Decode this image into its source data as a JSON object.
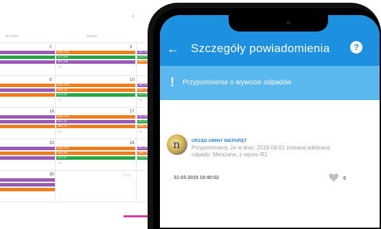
{
  "calendar": {
    "nav_icon": "chevron-left-icon",
    "nav_glyph": "‹",
    "day_headers": [
      "WTOREK",
      "ŚRODA"
    ],
    "colors": {
      "purple": "#9b59b6",
      "orange": "#f07c1c",
      "green": "#27a744"
    },
    "weeks": [
      {
        "day_a": "2",
        "day_b": "3",
        "bars_a": [
          {
            "label": "",
            "color": "purple"
          },
          {
            "label": "",
            "color": "green"
          },
          {
            "label": "",
            "color": "purple"
          }
        ],
        "bars_b": [
          {
            "label": "MSN, R15",
            "color": "orange"
          },
          {
            "label": "ZLN, R15",
            "color": "green"
          },
          {
            "label": "SEL, R15",
            "color": "purple"
          }
        ],
        "bars_c": [
          {
            "label": "SEL, R11",
            "color": "purple"
          },
          {
            "label": "ZLN, R11",
            "color": "green"
          },
          {
            "label": "MSN, R",
            "color": "orange"
          }
        ],
        "more_b": "+ 1",
        "more_c": ""
      },
      {
        "day_a": "9",
        "day_b": "10",
        "bars_a": [
          {
            "label": "",
            "color": "orange"
          },
          {
            "label": "",
            "color": "purple"
          },
          {
            "label": "",
            "color": "orange"
          }
        ],
        "bars_b": [
          {
            "label": "MSN, R15",
            "color": "orange"
          },
          {
            "label": "MSN, R9",
            "color": "orange"
          },
          {
            "label": "ZLN, R8",
            "color": "green"
          }
        ],
        "bars_c": [
          {
            "label": "SEL, R1",
            "color": "purple"
          },
          {
            "label": "MSN, R",
            "color": "orange"
          },
          {
            "label": "ZLN, R7",
            "color": "green"
          }
        ],
        "more_b": "+ 1",
        "more_c": "+ 1"
      },
      {
        "day_a": "16",
        "day_b": "17",
        "bars_a": [
          {
            "label": "",
            "color": "purple"
          },
          {
            "label": "",
            "color": "purple"
          },
          {
            "label": "",
            "color": "orange"
          }
        ],
        "bars_b": [
          {
            "label": "MSN, R15",
            "color": "orange"
          },
          {
            "label": "SEL, R9",
            "color": "purple"
          },
          {
            "label": "MSN, R4",
            "color": "orange"
          }
        ],
        "bars_c": [
          {
            "label": "SEL, R1",
            "color": "purple"
          },
          {
            "label": "ZLN, R1",
            "color": "green"
          },
          {
            "label": "MSN, R4",
            "color": "orange"
          }
        ],
        "more_b": "+ 1",
        "more_c": "+ 2"
      },
      {
        "day_a": "23",
        "day_b": "24",
        "bars_a": [
          {
            "label": "",
            "color": "purple"
          },
          {
            "label": "",
            "color": "orange"
          },
          {
            "label": "",
            "color": "purple"
          }
        ],
        "bars_b": [
          {
            "label": "MSN, R15",
            "color": "orange"
          },
          {
            "label": "MSN, R8",
            "color": "orange"
          },
          {
            "label": "ZLN, R7",
            "color": "green"
          }
        ],
        "bars_c": [
          {
            "label": "SEL, R15",
            "color": "purple"
          },
          {
            "label": "MSN, R8",
            "color": "orange"
          },
          {
            "label": "ZLN, R8",
            "color": "green"
          }
        ],
        "more_b": "+ 1",
        "more_c": ""
      },
      {
        "day_a": "30",
        "day_b": "",
        "bars_a": [
          {
            "label": "",
            "color": "purple"
          },
          {
            "label": "",
            "color": "purple"
          },
          {
            "label": "",
            "color": "orange"
          }
        ],
        "bars_b": [],
        "bars_c": [],
        "more_b": "",
        "more_c": "",
        "faded_label": "1 maj"
      }
    ]
  },
  "app": {
    "back_icon": "arrow-left-icon",
    "back_glyph": "←",
    "title": "Szczegóły powiadomienia",
    "help_glyph": "?",
    "banner_glyph": "!",
    "banner_text": "Przypomnienie o wywozie odpadów",
    "message": {
      "sender": "URZĄD GMINY NIEPORĘT",
      "body": "Przypominamy, że w dniu: 2019-04-01 zostaną odebrane odpady: Mieszane, z rejonu R1",
      "date": "31-03-2019 19:40:02",
      "likes": "0"
    },
    "colors": {
      "appbar": "#1e90e0",
      "banner": "#5bb8ef",
      "sender": "#2b7fd6",
      "accent_line": "#d63aa8"
    }
  }
}
